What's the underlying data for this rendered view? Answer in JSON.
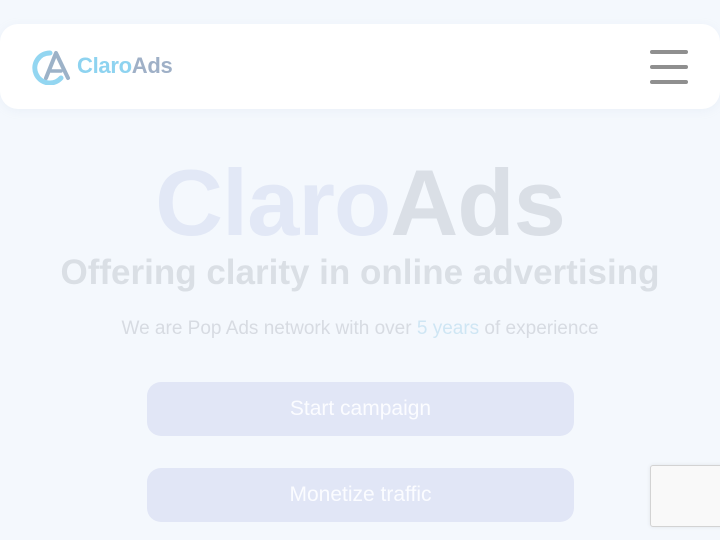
{
  "header": {
    "logo": {
      "text_claro": "Claro",
      "text_ads": "Ads",
      "icon": "claroads-logo-icon"
    },
    "menu": {
      "icon": "hamburger-menu-icon"
    }
  },
  "hero": {
    "title_part1": "Claro",
    "title_part2": "Ads",
    "subtitle": "Offering clarity in online advertising",
    "desc_before": "We are Pop Ads network with over ",
    "desc_highlight": "5 years",
    "desc_after": " of experience"
  },
  "buttons": {
    "start_campaign": "Start campaign",
    "monetize_traffic": "Monetize traffic"
  },
  "colors": {
    "page_bg": "#f4f8fd",
    "header_bg": "#ffffff",
    "button_bg": "#e1e6f6",
    "logo_claro": "#8ed3f0",
    "logo_ads": "#9fb0c7"
  }
}
